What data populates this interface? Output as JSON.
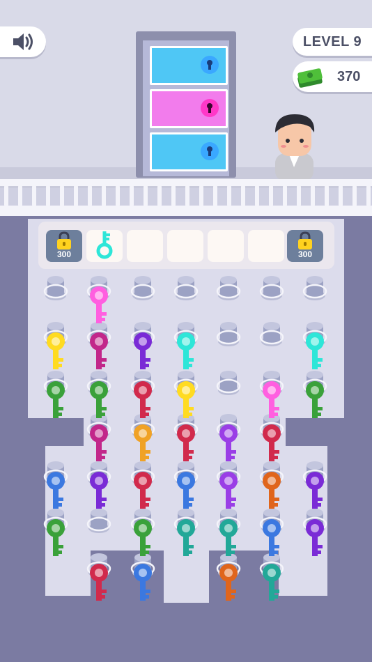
{
  "hud": {
    "level_label": "LEVEL 9",
    "cash_amount": "370",
    "sound_icon": "speaker-icon",
    "cash_icon": "cash-stack-icon"
  },
  "door": {
    "locks": [
      {
        "color": "#3aa8ff",
        "panel_color": "#4fc7f5",
        "icon": "keyhole-icon"
      },
      {
        "color": "#ff38c8",
        "panel_color": "#f27cec",
        "icon": "keyhole-icon"
      },
      {
        "color": "#3aa8ff",
        "panel_color": "#4fc7f5",
        "icon": "keyhole-icon"
      }
    ]
  },
  "slots": [
    {
      "state": "locked",
      "price": "300",
      "icon": "padlock-icon"
    },
    {
      "state": "key",
      "key_color": "#2ee6d8",
      "icon": "key-icon"
    },
    {
      "state": "empty"
    },
    {
      "state": "empty"
    },
    {
      "state": "empty"
    },
    {
      "state": "empty"
    },
    {
      "state": "locked",
      "price": "300",
      "icon": "padlock-icon"
    }
  ],
  "colors": {
    "pink": "#ff5fe0",
    "magenta": "#c2278a",
    "yellow": "#ffdb21",
    "green": "#3aa13a",
    "purple": "#7a2bd6",
    "violet": "#9a3ee6",
    "cyan": "#2ee6d8",
    "red": "#d12a4c",
    "orange": "#f0a226",
    "blue": "#3b78e0",
    "teal": "#22a898",
    "rust": "#e0651c",
    "board": "#dcdcec",
    "peg": "#9ca2c4"
  },
  "pegs": [
    {
      "col": 0,
      "row": 0
    },
    {
      "col": 1,
      "row": 0
    },
    {
      "col": 2,
      "row": 0
    },
    {
      "col": 3,
      "row": 0
    },
    {
      "col": 4,
      "row": 0
    },
    {
      "col": 5,
      "row": 0
    },
    {
      "col": 6,
      "row": 0
    },
    {
      "col": 0,
      "row": 1
    },
    {
      "col": 1,
      "row": 1
    },
    {
      "col": 2,
      "row": 1
    },
    {
      "col": 3,
      "row": 1
    },
    {
      "col": 4,
      "row": 1
    },
    {
      "col": 5,
      "row": 1
    },
    {
      "col": 6,
      "row": 1
    },
    {
      "col": 0,
      "row": 2
    },
    {
      "col": 1,
      "row": 2
    },
    {
      "col": 2,
      "row": 2
    },
    {
      "col": 3,
      "row": 2
    },
    {
      "col": 4,
      "row": 2
    },
    {
      "col": 5,
      "row": 2
    },
    {
      "col": 6,
      "row": 2
    },
    {
      "col": 1,
      "row": 3
    },
    {
      "col": 2,
      "row": 3
    },
    {
      "col": 3,
      "row": 3
    },
    {
      "col": 4,
      "row": 3
    },
    {
      "col": 5,
      "row": 3
    },
    {
      "col": 0,
      "row": 4
    },
    {
      "col": 1,
      "row": 4
    },
    {
      "col": 2,
      "row": 4
    },
    {
      "col": 3,
      "row": 4
    },
    {
      "col": 4,
      "row": 4
    },
    {
      "col": 5,
      "row": 4
    },
    {
      "col": 6,
      "row": 4
    },
    {
      "col": 0,
      "row": 5
    },
    {
      "col": 1,
      "row": 5
    },
    {
      "col": 2,
      "row": 5
    },
    {
      "col": 3,
      "row": 5
    },
    {
      "col": 4,
      "row": 5
    },
    {
      "col": 5,
      "row": 5
    },
    {
      "col": 6,
      "row": 5
    },
    {
      "col": 1,
      "row": 6
    },
    {
      "col": 2,
      "row": 6
    },
    {
      "col": 4,
      "row": 6
    },
    {
      "col": 5,
      "row": 6
    }
  ],
  "keys": [
    {
      "col": 1,
      "row": 1,
      "color": "magenta"
    },
    {
      "col": 1,
      "row": 0,
      "color": "pink"
    },
    {
      "col": 0,
      "row": 2,
      "color": "green"
    },
    {
      "col": 0,
      "row": 1,
      "color": "yellow"
    },
    {
      "col": 1,
      "row": 2,
      "color": "green"
    },
    {
      "col": 2,
      "row": 2,
      "color": "red"
    },
    {
      "col": 2,
      "row": 1,
      "color": "purple"
    },
    {
      "col": 3,
      "row": 1,
      "color": "cyan"
    },
    {
      "col": 6,
      "row": 2,
      "color": "green"
    },
    {
      "col": 6,
      "row": 1,
      "color": "cyan"
    },
    {
      "col": 1,
      "row": 3,
      "color": "magenta"
    },
    {
      "col": 2,
      "row": 3,
      "color": "orange"
    },
    {
      "col": 3,
      "row": 3,
      "color": "red"
    },
    {
      "col": 3,
      "row": 2,
      "color": "yellow"
    },
    {
      "col": 5,
      "row": 3,
      "color": "red"
    },
    {
      "col": 5,
      "row": 2,
      "color": "pink"
    },
    {
      "col": 4,
      "row": 4,
      "color": "violet"
    },
    {
      "col": 4,
      "row": 3,
      "color": "violet"
    },
    {
      "col": 0,
      "row": 4,
      "color": "blue"
    },
    {
      "col": 1,
      "row": 4,
      "color": "purple"
    },
    {
      "col": 2,
      "row": 4,
      "color": "red"
    },
    {
      "col": 3,
      "row": 4,
      "color": "blue"
    },
    {
      "col": 5,
      "row": 4,
      "color": "rust"
    },
    {
      "col": 6,
      "row": 4,
      "color": "purple"
    },
    {
      "col": 0,
      "row": 5,
      "color": "green"
    },
    {
      "col": 2,
      "row": 5,
      "color": "green"
    },
    {
      "col": 3,
      "row": 5,
      "color": "teal"
    },
    {
      "col": 4,
      "row": 5,
      "color": "teal"
    },
    {
      "col": 5,
      "row": 5,
      "color": "blue"
    },
    {
      "col": 6,
      "row": 5,
      "color": "purple"
    },
    {
      "col": 1,
      "row": 6,
      "color": "red"
    },
    {
      "col": 2,
      "row": 6,
      "color": "blue"
    },
    {
      "col": 4,
      "row": 6,
      "color": "rust"
    },
    {
      "col": 5,
      "row": 6,
      "color": "teal"
    }
  ]
}
